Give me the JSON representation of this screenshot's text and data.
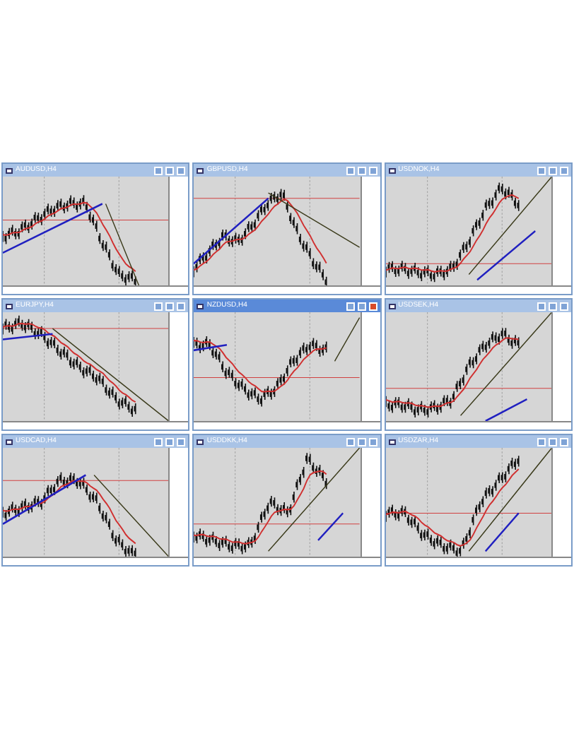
{
  "windows": [
    {
      "title": "AUDUSD,H4",
      "active": false
    },
    {
      "title": "GBPUSD,H4",
      "active": false
    },
    {
      "title": "USDNOK,H4",
      "active": false
    },
    {
      "title": "EURJPY,H4",
      "active": false
    },
    {
      "title": "NZDUSD,H4",
      "active": true
    },
    {
      "title": "USDSEK,H4",
      "active": false
    },
    {
      "title": "USDCAD,H4",
      "active": false
    },
    {
      "title": "USDDKK,H4",
      "active": false
    },
    {
      "title": "USDZAR,H4",
      "active": false
    }
  ]
}
